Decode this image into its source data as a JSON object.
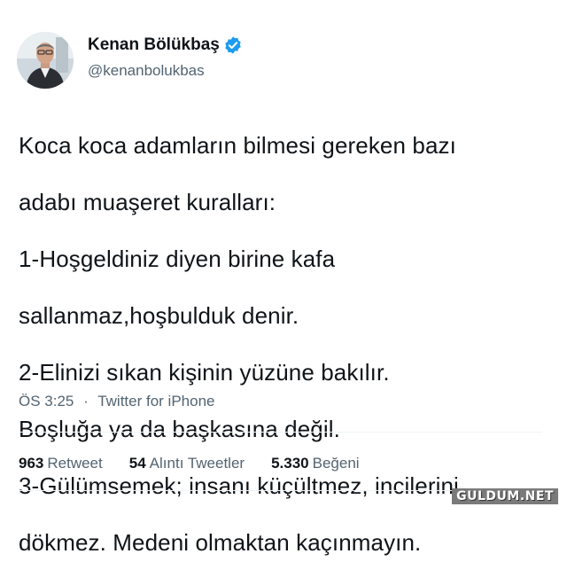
{
  "author": {
    "name": "Kenan Bölükbaş",
    "handle": "@kenanbolukbas",
    "verified_icon": "verified-badge-icon",
    "verified_color": "#1d9bf0"
  },
  "tweet": {
    "lines": [
      "Koca koca adamların bilmesi gereken bazı",
      "adabı muaşeret kuralları:",
      "1-Hoşgeldiniz diyen birine kafa",
      "sallanmaz,hoşbulduk denir.",
      "2-Elinizi sıkan kişinin yüzüne bakılır.",
      "Boşluğa ya da başkasına değil.",
      "3-Gülümsemek; insanı küçültmez, incilerini",
      "dökmez. Medeni olmaktan kaçınmayın."
    ]
  },
  "meta": {
    "time": "ÖS 3:25",
    "separator": "·",
    "source": "Twitter for iPhone"
  },
  "stats": {
    "retweets_count": "963",
    "retweets_label": "Retweet",
    "quotes_count": "54",
    "quotes_label": "Alıntı Tweetler",
    "likes_count": "5.330",
    "likes_label": "Beğeni"
  },
  "watermark": "GULDUM.NET",
  "colors": {
    "text_primary": "#0f1419",
    "text_secondary": "#536471",
    "divider": "#eff3f4"
  }
}
